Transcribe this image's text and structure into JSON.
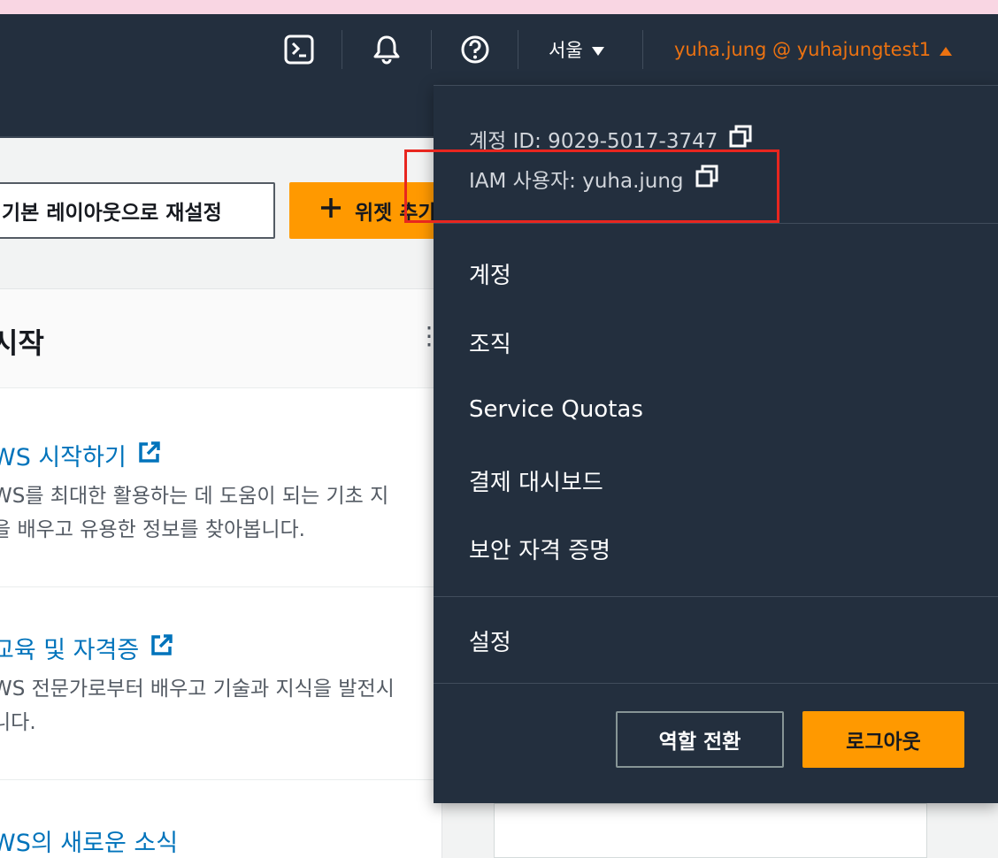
{
  "header": {
    "region_label": "서울",
    "account_label": "yuha.jung @ yuhajungtest1",
    "icons": [
      "cloudshell-icon",
      "bell-icon",
      "help-icon"
    ]
  },
  "toolbar": {
    "reset_label": "기본 레이아웃으로 재설정",
    "add_widget_label": "위젯 추가"
  },
  "widget": {
    "title": "시작",
    "items": [
      {
        "link": "WS 시작하기",
        "desc1": "WS를 최대한 활용하는 데 도움이 되는 기초 지",
        "desc2": "을 배우고 유용한 정보를 찾아봅니다."
      },
      {
        "link": "교육 및 자격증",
        "desc1": "WS 전문가로부터 배우고 기술과 지식을 발전시",
        "desc2": "니다."
      },
      {
        "link": "WS의 새로운 소식"
      }
    ]
  },
  "account_menu": {
    "account_id": "계정 ID: 9029-5017-3747",
    "iam_user": "IAM 사용자: yuha.jung",
    "items": [
      "계정",
      "조직",
      "Service Quotas",
      "결제 대시보드",
      "보안 자격 증명"
    ],
    "settings_label": "설정",
    "switch_role_label": "역할 전환",
    "logout_label": "로그아웃"
  },
  "colors": {
    "nav_bg": "#232f3e",
    "accent_orange": "#ff9900",
    "account_orange": "#ec7211",
    "link_blue": "#0073bb",
    "highlight_red": "#e8261f"
  }
}
